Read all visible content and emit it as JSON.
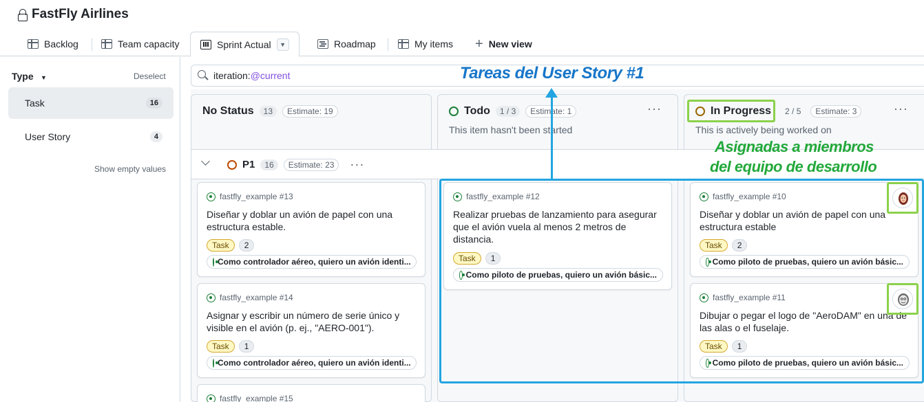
{
  "header": {
    "title": "FastFly Airlines"
  },
  "tabs": [
    {
      "label": "Backlog",
      "icon": "table-icon"
    },
    {
      "label": "Team capacity",
      "icon": "table-icon"
    },
    {
      "label": "Sprint Actual",
      "icon": "board-icon",
      "active": true
    },
    {
      "label": "Roadmap",
      "icon": "roadmap-icon"
    },
    {
      "label": "My items",
      "icon": "table-icon"
    },
    {
      "label": "New view",
      "icon": "plus-icon"
    }
  ],
  "sidebar": {
    "heading": "Type",
    "deselect": "Deselect",
    "items": [
      {
        "label": "Task",
        "count": "16",
        "selected": true
      },
      {
        "label": "User Story",
        "count": "4",
        "selected": false
      }
    ],
    "show_empty": "Show empty values"
  },
  "search": {
    "prefix": "iteration:",
    "value": "@current"
  },
  "columns": [
    {
      "title": "No Status",
      "count": "13",
      "estimate": "Estimate: 19",
      "description": ""
    },
    {
      "title": "Todo",
      "count": "1 / 3",
      "estimate": "Estimate: 1",
      "description": "This item hasn't been started",
      "color": "#1a7f37"
    },
    {
      "title": "In Progress",
      "count": "2 / 5",
      "estimate": "Estimate: 3",
      "description": "This is actively being worked on",
      "color": "#9a6700"
    }
  ],
  "group": {
    "name": "P1",
    "count": "16",
    "estimate": "Estimate: 23"
  },
  "cards": {
    "no_status": [
      {
        "ref": "fastfly_example #13",
        "title": "Diseñar y doblar un avión de papel con una estructura estable.",
        "label": "Task",
        "points": "2",
        "parent": "Como controlador aéreo, quiero un avión identi..."
      },
      {
        "ref": "fastfly_example #14",
        "title": "Asignar y escribir un número de serie único y visible en el avión (p. ej., \"AERO-001\").",
        "label": "Task",
        "points": "1",
        "parent": "Como controlador aéreo, quiero un avión identi..."
      },
      {
        "ref": "fastfly_example #15"
      }
    ],
    "todo": [
      {
        "ref": "fastfly_example #12",
        "title": "Realizar pruebas de lanzamiento para asegurar que el avión vuela al menos 2 metros de distancia.",
        "label": "Task",
        "points": "1",
        "parent": "Como piloto de pruebas, quiero un avión básic..."
      }
    ],
    "in_progress": [
      {
        "ref": "fastfly_example #10",
        "title": "Diseñar y doblar un avión de papel con una estructura estable",
        "label": "Task",
        "points": "2",
        "parent": "Como piloto de pruebas, quiero un avión básic..."
      },
      {
        "ref": "fastfly_example #11",
        "title": "Dibujar o pegar el logo de \"AeroDAM\" en una de las alas o el fuselaje.",
        "label": "Task",
        "points": "1",
        "parent": "Como piloto de pruebas, quiero un avión básic..."
      }
    ]
  },
  "annotations": {
    "top": "Tareas del User Story #1",
    "right_line1": "Asignadas a miembros",
    "right_line2": "del equipo de desarrollo",
    "blue": "#22a5e0",
    "green": "#8bd14b"
  }
}
